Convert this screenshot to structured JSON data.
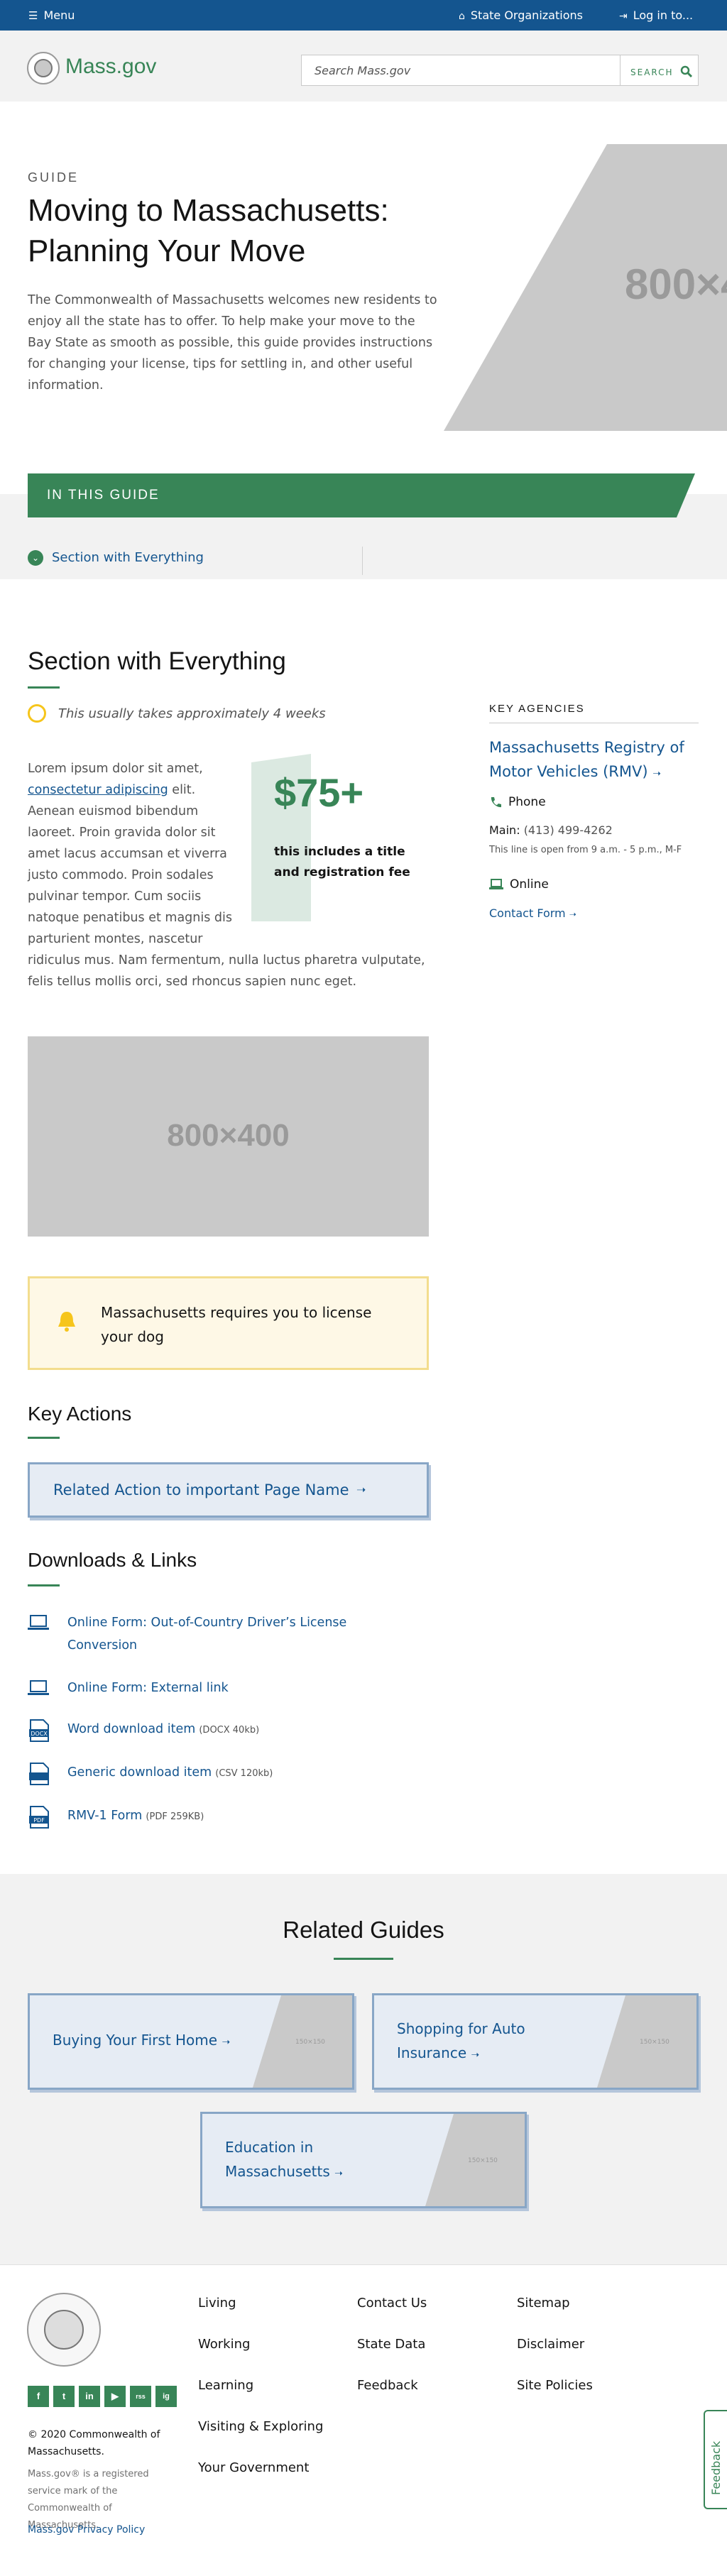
{
  "topbar": {
    "menu_label": "Menu",
    "state_orgs_label": "State Organizations",
    "login_label": "Log in to..."
  },
  "header": {
    "logo_text": "Mass.gov",
    "search_placeholder": "Search Mass.gov",
    "search_button": "SEARCH"
  },
  "hero": {
    "eyebrow": "GUIDE",
    "title": "Moving to Massachusetts: Planning Your Move",
    "description": "The Commonwealth of Massachusetts welcomes new residents to enjoy all the state has to offer. To help make your move to the Bay State as smooth as possible, this guide provides instructions for changing your license, tips for settling in, and other useful information.",
    "image_placeholder": "800×4"
  },
  "in_this_guide": {
    "label": "IN THIS GUIDE",
    "links": [
      "Section with Everything"
    ]
  },
  "section": {
    "title": "Section with Everything",
    "time_estimate": "This usually takes approximately 4 weeks",
    "body_before_link": "Lorem ipsum dolor sit amet, ",
    "body_link": "consectetur adipiscing",
    "body_after_link": " elit. Aenean euismod bibendum laoreet. Proin gravida dolor sit amet lacus accumsan et viverra justo commodo. Proin sodales pulvinar tempor. Cum sociis natoque penatibus et magnis dis parturient montes, nascetur ridiculus mus. Nam fermentum, nulla luctus pharetra vulputate, felis tellus mollis orci, sed rhoncus sapien nunc eget.",
    "callout_amount": "$75+",
    "callout_text": "this includes a title and registration fee",
    "image_placeholder": "800×400",
    "alert_text": "Massachusetts requires you to license your dog"
  },
  "key_actions": {
    "title": "Key Actions",
    "button_label": "Related Action to important Page Name"
  },
  "downloads": {
    "title": "Downloads & Links",
    "items": [
      {
        "label": "Online Form: Out-of-Country Driver’s License Conversion",
        "meta": "",
        "icon": "laptop-icon"
      },
      {
        "label": "Online Form: External link",
        "meta": "",
        "icon": "laptop-icon"
      },
      {
        "label": "Word download item",
        "meta": "(DOCX 40kb)",
        "icon": "docx-file-icon",
        "badge": "DOCX"
      },
      {
        "label": "Generic download item",
        "meta": "(CSV 120kb)",
        "icon": "generic-file-icon",
        "badge": ""
      },
      {
        "label": "RMV-1 Form",
        "meta": "(PDF 259KB)",
        "icon": "pdf-file-icon",
        "badge": "PDF"
      }
    ]
  },
  "key_agencies": {
    "label": "KEY AGENCIES",
    "agency_name": "Massachusetts Registry of Motor Vehicles (RMV)",
    "phone_label": "Phone",
    "phone_main_label": "Main:",
    "phone_number": "(413) 499-4262",
    "phone_hours": "This line is open from 9 a.m. - 5 p.m., M-F",
    "online_label": "Online",
    "contact_form": "Contact Form"
  },
  "related_guides": {
    "title": "Related Guides",
    "cards": [
      {
        "label": "Buying Your First Home",
        "thumb": "150×150"
      },
      {
        "label": "Shopping for Auto Insurance",
        "thumb": "150×150"
      },
      {
        "label": "Education in Massachusetts",
        "thumb": "150×150"
      }
    ]
  },
  "footer": {
    "social": [
      "f",
      "t",
      "in",
      "▶",
      "rss",
      "ig"
    ],
    "copyright": "© 2020 Commonwealth of Massachusetts.",
    "trademark": "Mass.gov® is a registered service mark of the Commonwealth of Massachusetts.",
    "privacy": "Mass.gov Privacy Policy",
    "col1": [
      "Living",
      "Working",
      "Learning",
      "Visiting & Exploring",
      "Your Government"
    ],
    "col2": [
      "Contact Us",
      "State Data",
      "Feedback"
    ],
    "col3": [
      "Sitemap",
      "Disclaimer",
      "Site Policies"
    ],
    "feedback_tab": "Feedback"
  },
  "colors": {
    "brand_blue": "#14558f",
    "brand_green": "#388557",
    "alert_yellow": "#f6c51b"
  }
}
